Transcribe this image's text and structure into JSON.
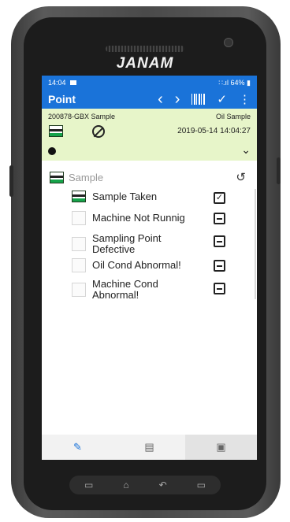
{
  "device": {
    "brand": "JANAM"
  },
  "status_bar": {
    "time": "14:04",
    "mail_icon": "mail-icon",
    "signal": "∷.ıl 64% ▮"
  },
  "app_bar": {
    "title": "Point",
    "prev_glyph": "‹",
    "next_glyph": "›",
    "confirm_glyph": "✓",
    "menu_glyph": "⋮"
  },
  "info": {
    "id": "200878-GBX Sample",
    "type": "Oil Sample",
    "datetime": "2019-05-14 14:04:27",
    "expand_glyph": "⌄"
  },
  "section": {
    "title": "Sample",
    "history_glyph": "↺"
  },
  "items": [
    {
      "label": "Sample Taken",
      "state_glyph": "✓",
      "state": "checked"
    },
    {
      "label": "Machine Not Runnig",
      "state_glyph": "",
      "state": "minus"
    },
    {
      "label": "Sampling Point Defective",
      "state_glyph": "",
      "state": "minus"
    },
    {
      "label": "Oil Cond Abnormal!",
      "state_glyph": "",
      "state": "minus"
    },
    {
      "label": "Machine Cond Abnormal!",
      "state_glyph": "",
      "state": "minus"
    }
  ],
  "bottom_tabs": [
    {
      "icon": "edit-icon",
      "glyph": "✎"
    },
    {
      "icon": "comment-icon",
      "glyph": "▤"
    },
    {
      "icon": "image-icon",
      "glyph": "▣"
    }
  ],
  "nav": {
    "recent": "▭",
    "home": "⌂",
    "back": "↶",
    "menu": "▭"
  },
  "colors": {
    "accent": "#1a73d9",
    "panel": "#e7f5c9",
    "green": "#16a34a"
  }
}
